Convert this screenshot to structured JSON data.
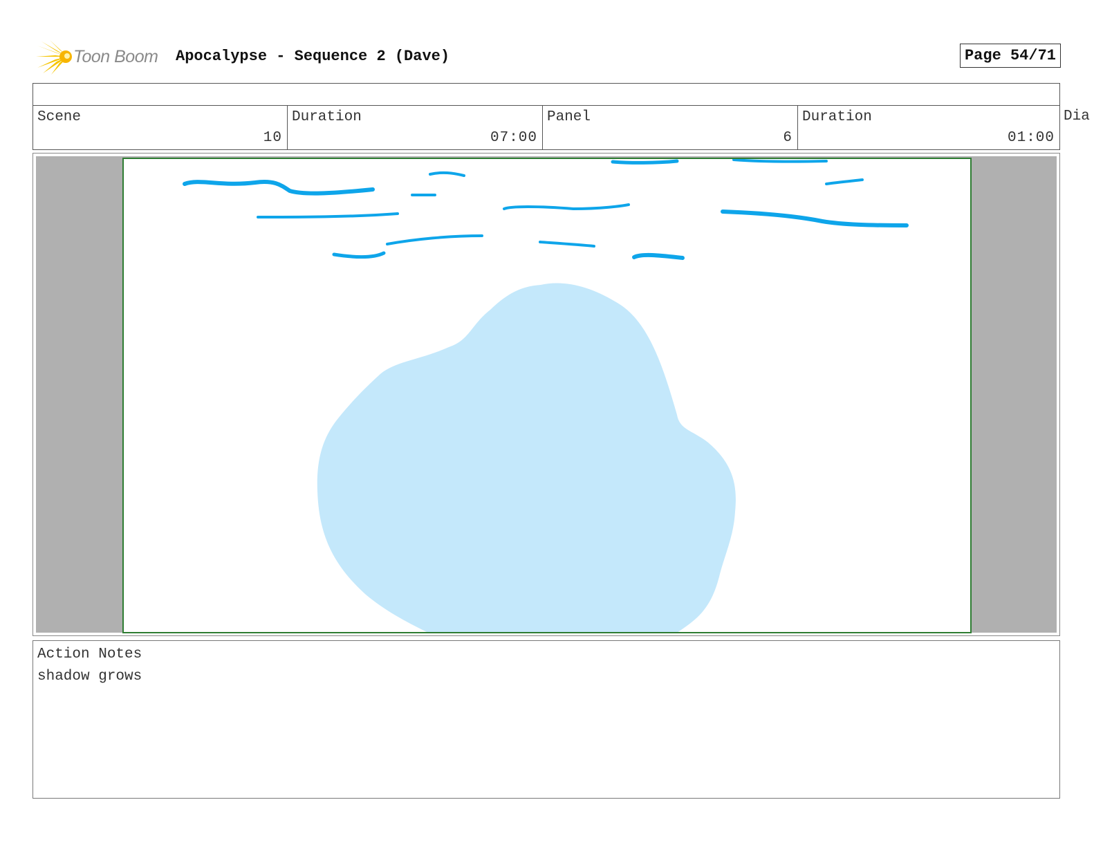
{
  "header": {
    "logo_text": "Toon Boom",
    "title": "Apocalypse - Sequence 2 (Dave)",
    "page_label": "Page 54/71"
  },
  "info": {
    "scene_label": "Scene",
    "scene_value": "10",
    "scene_duration_label": "Duration",
    "scene_duration_value": "07:00",
    "panel_label": "Panel",
    "panel_value": "6",
    "panel_duration_label": "Duration",
    "panel_duration_value": "01:00",
    "dialog_label_partial": "Dia"
  },
  "notes": {
    "label": "Action Notes",
    "text": "shadow grows"
  },
  "colors": {
    "stroke_blue": "#0ea5ea",
    "shadow_blue": "#c4e8fb",
    "frame_green": "#2e7d32",
    "panel_gray": "#b0b0b0",
    "logo_yellow": "#f5c400"
  }
}
